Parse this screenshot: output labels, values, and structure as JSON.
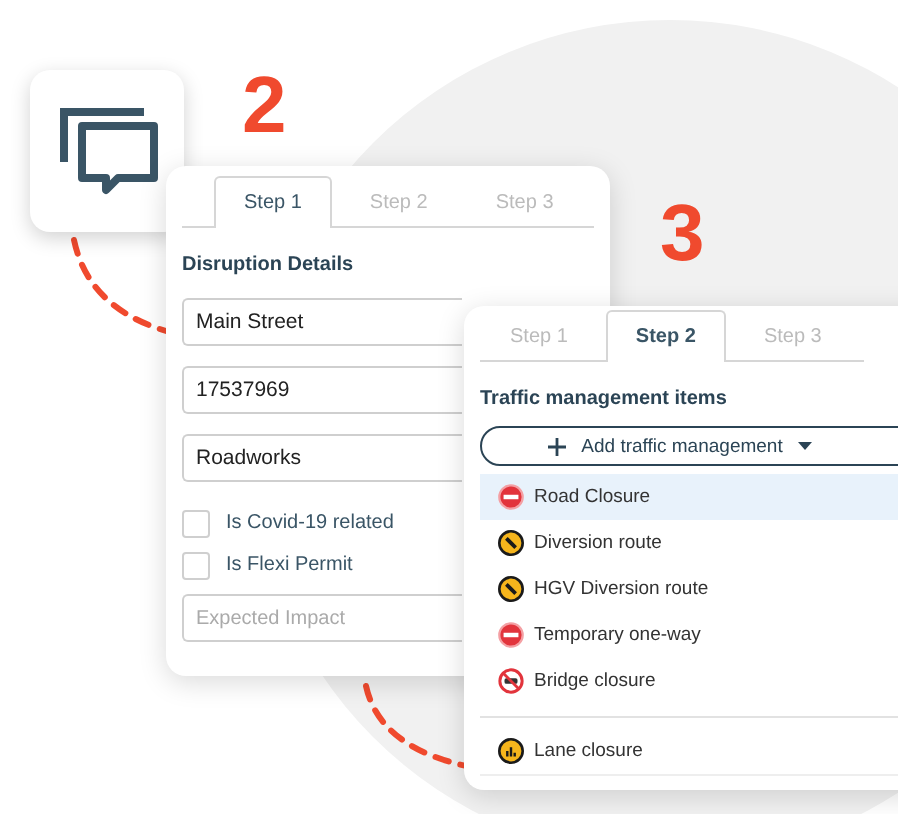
{
  "callouts": [
    "2",
    "3"
  ],
  "details_card": {
    "tabs": [
      {
        "label": "Step 1",
        "selected": true
      },
      {
        "label": "Step 2",
        "selected": false
      },
      {
        "label": "Step 3",
        "selected": false
      }
    ],
    "heading": "Disruption Details",
    "fields": [
      {
        "value": "Main Street"
      },
      {
        "value": "17537969"
      },
      {
        "value": "Roadworks"
      }
    ],
    "checkboxes": [
      {
        "label": "Is Covid-19 related",
        "checked": false
      },
      {
        "label": "Is Flexi Permit",
        "checked": false
      }
    ],
    "impact_field": {
      "placeholder": "Expected Impact"
    }
  },
  "traffic_card": {
    "tabs": [
      {
        "label": "Step 1",
        "selected": false
      },
      {
        "label": "Step 2",
        "selected": true
      },
      {
        "label": "Step 3",
        "selected": false
      }
    ],
    "heading": "Traffic management items",
    "add_button": {
      "label": "Add traffic management"
    },
    "item_groups": [
      [
        {
          "label": "Road Closure",
          "kind": "no-entry",
          "selected": true
        },
        {
          "label": "Diversion route",
          "kind": "diversion",
          "selected": false
        },
        {
          "label": "HGV Diversion route",
          "kind": "diversion",
          "selected": false
        },
        {
          "label": "Temporary one-way",
          "kind": "no-entry",
          "selected": false
        },
        {
          "label": "Bridge closure",
          "kind": "no-vehicles",
          "selected": false
        }
      ],
      [
        {
          "label": "Lane closure",
          "kind": "lane",
          "selected": false
        }
      ]
    ]
  }
}
